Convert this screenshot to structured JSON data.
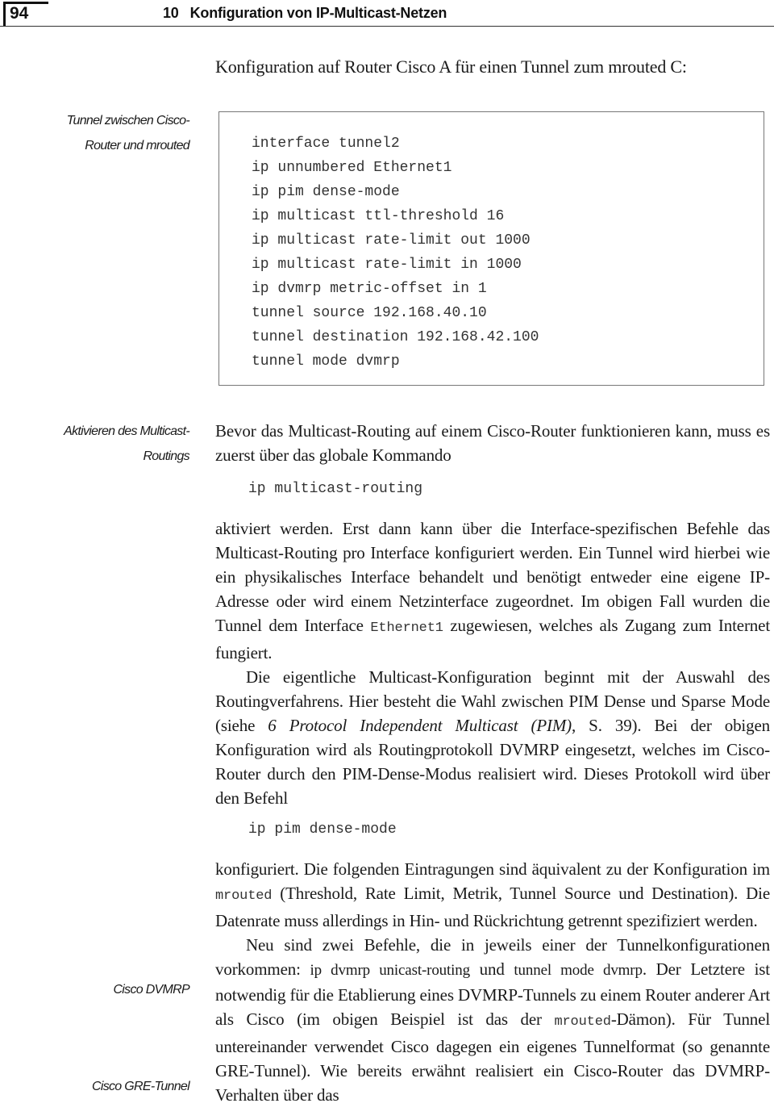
{
  "header": {
    "page_number": "94",
    "chapter_number": "10",
    "chapter_title": "Konfiguration von IP-Multicast-Netzen"
  },
  "intro": "Konfiguration auf Router Cisco A für einen Tunnel zum mrouted C:",
  "margin_notes": {
    "tunnel": [
      "Tunnel zwischen Cisco-",
      "Router und mrouted"
    ],
    "activate": [
      "Aktivieren des Multicast-",
      "Routings"
    ],
    "dvmrp": "Cisco DVMRP",
    "gre": "Cisco GRE-Tunnel"
  },
  "config_listing": [
    "interface tunnel2",
    "ip unnumbered Ethernet1",
    "ip pim dense-mode",
    "ip multicast ttl-threshold 16",
    "ip multicast rate-limit out 1000",
    "ip multicast rate-limit in 1000",
    "ip dvmrp metric-offset in 1",
    "tunnel source 192.168.40.10",
    "tunnel destination 192.168.42.100",
    "tunnel mode dvmrp"
  ],
  "para1": "Bevor das Multicast-Routing auf einem Cisco-Router funktionieren kann, muss es zuerst über das globale Kommando",
  "cmd1": "ip multicast-routing",
  "para2": {
    "text_a": "aktiviert werden. Erst dann kann über die Interface-spezifischen Befehle das Multicast-Routing pro Interface konfiguriert werden. Ein Tunnel wird hierbei wie ein physikalisches Interface behandelt und benötigt entweder eine eigene IP-Adresse oder wird einem Netzinterface zugeordnet. Im obigen Fall wurden die Tunnel dem Interface ",
    "code": "Ethernet1",
    "text_b": " zugewiesen, welches als Zugang zum Internet fungiert."
  },
  "para3": {
    "text_a": "Die eigentliche Multicast-Konfiguration beginnt mit der Auswahl des Routingverfahrens. Hier besteht die Wahl zwischen PIM Dense und Sparse Mode (siehe ",
    "ref": "6 Protocol Independent Multicast (PIM)",
    "text_b": ", S. 39). Bei der obigen Konfiguration wird als Routingprotokoll DVMRP eingesetzt, welches im Cisco-Router durch den PIM-Dense-Modus realisiert wird. Dieses Protokoll wird über den Befehl"
  },
  "cmd2": "ip pim dense-mode",
  "para4": {
    "text_a": "konfiguriert. Die folgenden Eintragungen sind äquivalent zu der Konfiguration im ",
    "code": "mrouted",
    "text_b": " (Threshold, Rate Limit, Metrik, Tunnel Source und Destination). Die Datenrate muss allerdings in Hin- und Rückrichtung getrennt spezifiziert werden."
  },
  "para5": {
    "text_a": "Neu sind zwei Befehle, die in jeweils einer der Tunnelkonfigurationen vorkommen: ",
    "cmd_a": "ip dvmrp unicast-routing",
    "text_b": " und ",
    "cmd_b": "tunnel mode dvmrp",
    "text_c": ". Der Letztere ist notwendig für die Etablierung eines DVMRP-Tunnels zu einem Router anderer Art als Cisco (im obigen Beispiel ist das der ",
    "code": "mrouted",
    "text_d": "-Dämon). Für Tunnel untereinander verwendet Cisco dagegen ein eigenes Tunnelformat (so genannte GRE-Tunnel). Wie bereits erwähnt realisiert ein Cisco-Router das DVMRP-Verhalten über das"
  }
}
